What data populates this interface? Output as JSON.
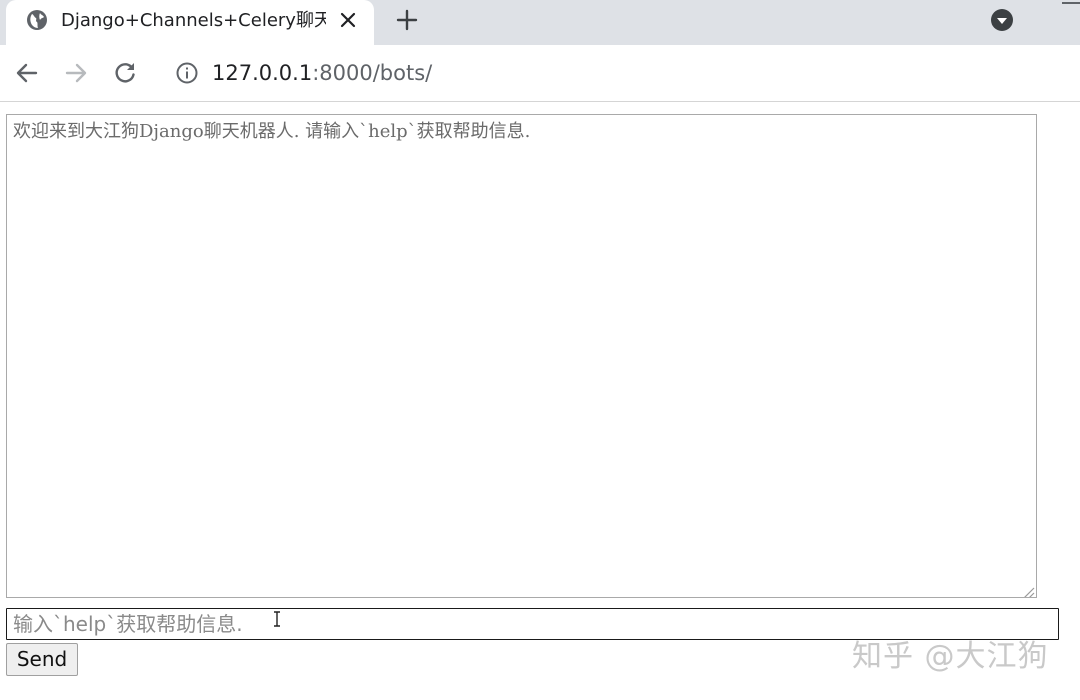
{
  "browser": {
    "tab": {
      "title": "Django+Channels+Celery聊天机器人"
    },
    "address_bar": {
      "host": "127.0.0.1",
      "rest": ":8000/bots/"
    }
  },
  "page": {
    "chat_log_text": "欢迎来到大江狗Django聊天机器人. 请输入`help`获取帮助信息.",
    "message_input": {
      "value": "",
      "placeholder": "输入`help`获取帮助信息."
    },
    "send_label": "Send"
  },
  "watermark": "知乎 @大江狗",
  "icons": {
    "favicon": "globe-icon",
    "tab_close": "close-icon",
    "new_tab": "plus-icon",
    "tab_menu": "dropdown-icon",
    "back": "back-arrow-icon",
    "forward": "forward-arrow-icon",
    "reload": "reload-icon",
    "site_info": "info-icon",
    "cursor": "text-cursor-icon"
  }
}
